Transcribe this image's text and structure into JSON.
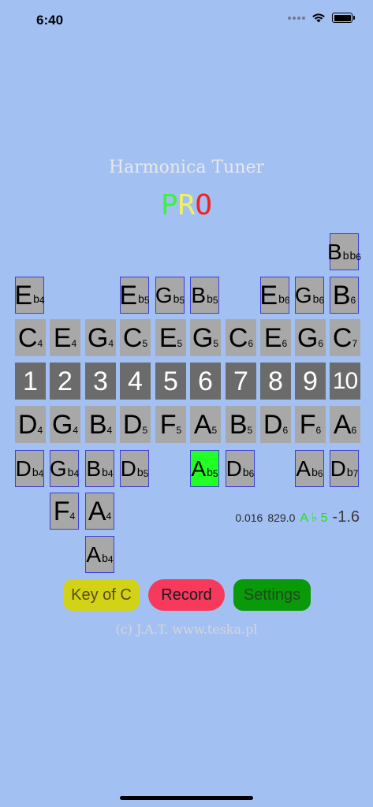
{
  "status": {
    "time": "6:40"
  },
  "header": {
    "title": "Harmonica Tuner",
    "pro": [
      "P",
      "R",
      "O"
    ]
  },
  "board": {
    "r0": [
      {
        "n": "B",
        "a": "b",
        "a2": "b",
        "o": "6"
      }
    ],
    "r1": [
      {
        "n": "E",
        "a": "b",
        "o": "4"
      },
      {
        "n": "E",
        "a": "b",
        "o": "5"
      },
      {
        "n": "G",
        "a": "b",
        "o": "5"
      },
      {
        "n": "B",
        "a": "b",
        "o": "5"
      },
      {
        "n": "E",
        "a": "b",
        "o": "6"
      },
      {
        "n": "G",
        "a": "b",
        "o": "6"
      },
      {
        "n": "B",
        "a": "",
        "o": "6"
      }
    ],
    "r2": [
      {
        "n": "C",
        "o": "4"
      },
      {
        "n": "E",
        "o": "4"
      },
      {
        "n": "G",
        "o": "4"
      },
      {
        "n": "C",
        "o": "5"
      },
      {
        "n": "E",
        "o": "5"
      },
      {
        "n": "G",
        "o": "5"
      },
      {
        "n": "C",
        "o": "6"
      },
      {
        "n": "E",
        "o": "6"
      },
      {
        "n": "G",
        "o": "6"
      },
      {
        "n": "C",
        "o": "7"
      }
    ],
    "holes": [
      "1",
      "2",
      "3",
      "4",
      "5",
      "6",
      "7",
      "8",
      "9",
      "10"
    ],
    "r4": [
      {
        "n": "D",
        "o": "4"
      },
      {
        "n": "G",
        "o": "4"
      },
      {
        "n": "B",
        "o": "4"
      },
      {
        "n": "D",
        "o": "5"
      },
      {
        "n": "F",
        "o": "5"
      },
      {
        "n": "A",
        "o": "5"
      },
      {
        "n": "B",
        "o": "5"
      },
      {
        "n": "D",
        "o": "6"
      },
      {
        "n": "F",
        "o": "6"
      },
      {
        "n": "A",
        "o": "6"
      }
    ],
    "r5": [
      {
        "n": "D",
        "a": "b",
        "o": "4"
      },
      {
        "n": "G",
        "a": "b",
        "o": "4"
      },
      {
        "n": "B",
        "a": "b",
        "o": "4"
      },
      {
        "n": "D",
        "a": "b",
        "o": "5"
      },
      {
        "n": "A",
        "a": "b",
        "o": "5"
      },
      {
        "n": "D",
        "a": "b",
        "o": "6"
      },
      {
        "n": "A",
        "a": "b",
        "o": "6"
      },
      {
        "n": "D",
        "a": "b",
        "o": "7"
      }
    ],
    "r6": [
      {
        "n": "F",
        "o": "4"
      },
      {
        "n": "A",
        "o": "4"
      }
    ],
    "r7": [
      {
        "n": "A",
        "a": "b",
        "o": "4"
      }
    ]
  },
  "readout": {
    "amplitude": "0.016",
    "frequency": "829.0",
    "note": "A ♭ 5",
    "deviation": "-1.6"
  },
  "buttons": {
    "key": "Key of C",
    "record": "Record",
    "settings": "Settings"
  },
  "footer": "(c) J.A.T. www.teska.pl",
  "colors": {
    "background": "#a3c0f3",
    "cell": "#a8a8a8",
    "hole": "#6b6b6b",
    "active": "#22ff22",
    "key": "#d2d316",
    "record": "#f7395b",
    "settings": "#099909"
  }
}
